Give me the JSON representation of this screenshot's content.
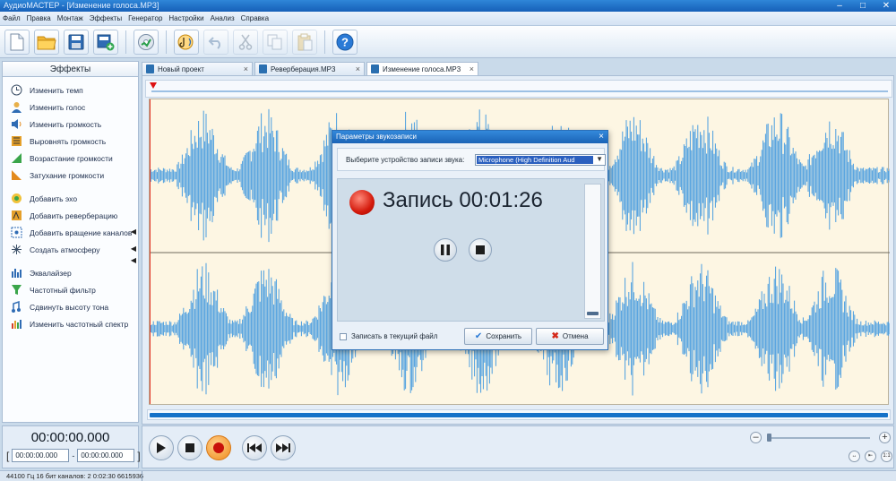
{
  "window": {
    "title": "АудиоМАСТЕР - [Изменение голоса.MP3]"
  },
  "menu": {
    "items": [
      "Файл",
      "Правка",
      "Монтаж",
      "Эффекты",
      "Генератор",
      "Настройки",
      "Анализ",
      "Справка"
    ]
  },
  "toolbar": {
    "buttons": [
      "new-file",
      "open-folder",
      "save",
      "save-as",
      "cd-burn",
      "record",
      "undo",
      "cut",
      "copy",
      "paste",
      "help"
    ]
  },
  "effects_panel": {
    "header": "Эффекты",
    "items": [
      {
        "label": "Изменить темп",
        "icon": "clock-icon"
      },
      {
        "label": "Изменить голос",
        "icon": "person-icon"
      },
      {
        "label": "Изменить громкость",
        "icon": "speaker-icon"
      },
      {
        "label": "Выровнять громкость",
        "icon": "level-icon"
      },
      {
        "label": "Возрастание громкости",
        "icon": "fade-in-icon"
      },
      {
        "label": "Затухание громкости",
        "icon": "fade-out-icon"
      },
      {
        "label": "Добавить эхо",
        "icon": "echo-icon"
      },
      {
        "label": "Добавить реверберацию",
        "icon": "reverb-icon"
      },
      {
        "label": "Добавить вращение каналов",
        "icon": "rotate-icon"
      },
      {
        "label": "Создать атмосферу",
        "icon": "atmosphere-icon"
      },
      {
        "label": "Эквалайзер",
        "icon": "equalizer-icon"
      },
      {
        "label": "Частотный фильтр",
        "icon": "funnel-icon"
      },
      {
        "label": "Сдвинуть высоту тона",
        "icon": "pitch-icon"
      },
      {
        "label": "Изменить частотный спектр",
        "icon": "spectrum-icon"
      }
    ]
  },
  "tabs": [
    {
      "label": "Новый проект",
      "active": false
    },
    {
      "label": "Реверберация.MP3",
      "active": false
    },
    {
      "label": "Изменение голоса.MP3",
      "active": true
    }
  ],
  "time": {
    "current": "00:00:00.000",
    "sel_start": "00:00:00.000",
    "sel_sep": "-",
    "sel_end": "00:00:00.000"
  },
  "status": {
    "text": "44100 Гц  16 бит  каналов: 2   0:02:30 6615936"
  },
  "zoom": {
    "buttons": [
      "fit-width",
      "fit-selection",
      "1:1"
    ],
    "one_to_one": "1:1"
  },
  "dialog": {
    "title": "Параметры звукозаписи",
    "device_label": "Выберите устройство записи звука:",
    "device_value": "Microphone (High Definition Aud",
    "status_label": "Запись",
    "elapsed": "00:01:26",
    "record_to_current_label": "Записать в текущий файл",
    "save_label": "Сохранить",
    "cancel_label": "Отмена"
  },
  "colors": {
    "accent": "#1571c8",
    "wave": "#4a9ee0",
    "wave_bg": "#fdf6e3",
    "record": "#d41a0c"
  }
}
